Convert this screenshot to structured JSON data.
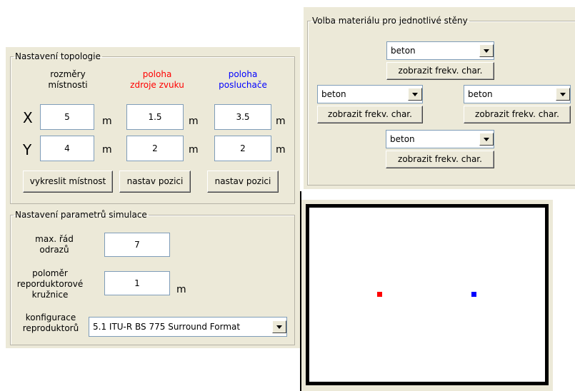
{
  "topology": {
    "legend": "Nastavení topologie",
    "col_room_label": "rozměry\nmístnosti",
    "col_source_label": "poloha\nzdroje zvuku",
    "col_listener_label": "poloha\nposluchače",
    "x_label": "X",
    "y_label": "Y",
    "unit": "m",
    "room_x": "5",
    "room_y": "4",
    "source_x": "1.5",
    "source_y": "2",
    "listener_x": "3.5",
    "listener_y": "2",
    "draw_room_button": "vykreslit místnost",
    "set_source_button": "nastav pozici",
    "set_listener_button": "nastav pozici",
    "colors": {
      "source": "#ff0000",
      "listener": "#0000ff"
    }
  },
  "simulation": {
    "legend": "Nastavení parametrů simulace",
    "max_order_label": "max. řád\nodrazů",
    "max_order_value": "7",
    "radius_label": "poloměr\nreporduktorové\nkružnice",
    "radius_value": "1",
    "radius_unit": "m",
    "config_label": "konfigurace\nreproduktorů",
    "config_value": "5.1 ITU-R BS 775 Surround Format"
  },
  "materials": {
    "legend": "Volba materiálu pro jednotlivé stěny",
    "top_value": "beton",
    "left_value": "beton",
    "right_value": "beton",
    "bottom_value": "beton",
    "show_button": "zobrazit frekv. char."
  },
  "room_view": {
    "source_x_m": 1.5,
    "source_y_m": 2,
    "listener_x_m": 3.5,
    "listener_y_m": 2,
    "room_width_m": 5,
    "room_height_m": 4
  }
}
